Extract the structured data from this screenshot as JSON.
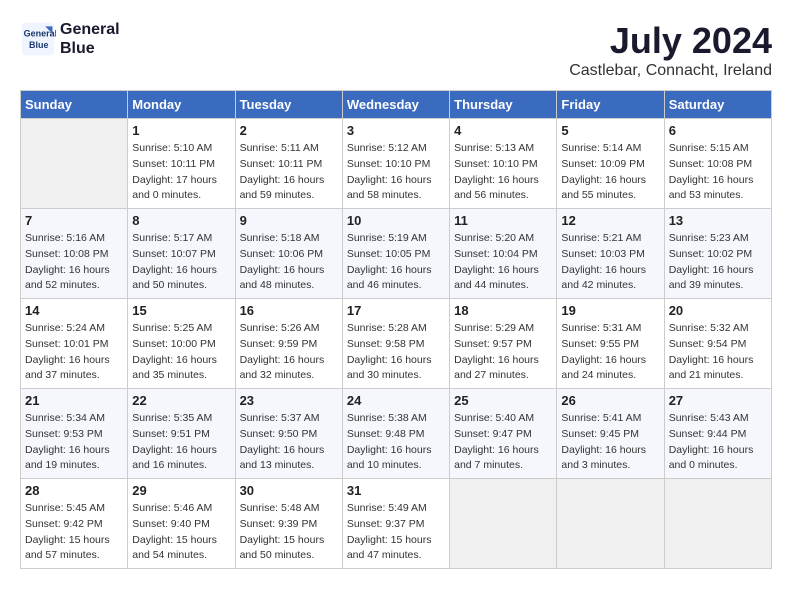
{
  "header": {
    "logo_line1": "General",
    "logo_line2": "Blue",
    "month": "July 2024",
    "location": "Castlebar, Connacht, Ireland"
  },
  "calendar": {
    "days_of_week": [
      "Sunday",
      "Monday",
      "Tuesday",
      "Wednesday",
      "Thursday",
      "Friday",
      "Saturday"
    ],
    "weeks": [
      [
        {
          "day": "",
          "empty": true
        },
        {
          "day": "1",
          "sunrise": "5:10 AM",
          "sunset": "10:11 PM",
          "daylight": "17 hours and 0 minutes."
        },
        {
          "day": "2",
          "sunrise": "5:11 AM",
          "sunset": "10:11 PM",
          "daylight": "16 hours and 59 minutes."
        },
        {
          "day": "3",
          "sunrise": "5:12 AM",
          "sunset": "10:10 PM",
          "daylight": "16 hours and 58 minutes."
        },
        {
          "day": "4",
          "sunrise": "5:13 AM",
          "sunset": "10:10 PM",
          "daylight": "16 hours and 56 minutes."
        },
        {
          "day": "5",
          "sunrise": "5:14 AM",
          "sunset": "10:09 PM",
          "daylight": "16 hours and 55 minutes."
        },
        {
          "day": "6",
          "sunrise": "5:15 AM",
          "sunset": "10:08 PM",
          "daylight": "16 hours and 53 minutes."
        }
      ],
      [
        {
          "day": "7",
          "sunrise": "5:16 AM",
          "sunset": "10:08 PM",
          "daylight": "16 hours and 52 minutes."
        },
        {
          "day": "8",
          "sunrise": "5:17 AM",
          "sunset": "10:07 PM",
          "daylight": "16 hours and 50 minutes."
        },
        {
          "day": "9",
          "sunrise": "5:18 AM",
          "sunset": "10:06 PM",
          "daylight": "16 hours and 48 minutes."
        },
        {
          "day": "10",
          "sunrise": "5:19 AM",
          "sunset": "10:05 PM",
          "daylight": "16 hours and 46 minutes."
        },
        {
          "day": "11",
          "sunrise": "5:20 AM",
          "sunset": "10:04 PM",
          "daylight": "16 hours and 44 minutes."
        },
        {
          "day": "12",
          "sunrise": "5:21 AM",
          "sunset": "10:03 PM",
          "daylight": "16 hours and 42 minutes."
        },
        {
          "day": "13",
          "sunrise": "5:23 AM",
          "sunset": "10:02 PM",
          "daylight": "16 hours and 39 minutes."
        }
      ],
      [
        {
          "day": "14",
          "sunrise": "5:24 AM",
          "sunset": "10:01 PM",
          "daylight": "16 hours and 37 minutes."
        },
        {
          "day": "15",
          "sunrise": "5:25 AM",
          "sunset": "10:00 PM",
          "daylight": "16 hours and 35 minutes."
        },
        {
          "day": "16",
          "sunrise": "5:26 AM",
          "sunset": "9:59 PM",
          "daylight": "16 hours and 32 minutes."
        },
        {
          "day": "17",
          "sunrise": "5:28 AM",
          "sunset": "9:58 PM",
          "daylight": "16 hours and 30 minutes."
        },
        {
          "day": "18",
          "sunrise": "5:29 AM",
          "sunset": "9:57 PM",
          "daylight": "16 hours and 27 minutes."
        },
        {
          "day": "19",
          "sunrise": "5:31 AM",
          "sunset": "9:55 PM",
          "daylight": "16 hours and 24 minutes."
        },
        {
          "day": "20",
          "sunrise": "5:32 AM",
          "sunset": "9:54 PM",
          "daylight": "16 hours and 21 minutes."
        }
      ],
      [
        {
          "day": "21",
          "sunrise": "5:34 AM",
          "sunset": "9:53 PM",
          "daylight": "16 hours and 19 minutes."
        },
        {
          "day": "22",
          "sunrise": "5:35 AM",
          "sunset": "9:51 PM",
          "daylight": "16 hours and 16 minutes."
        },
        {
          "day": "23",
          "sunrise": "5:37 AM",
          "sunset": "9:50 PM",
          "daylight": "16 hours and 13 minutes."
        },
        {
          "day": "24",
          "sunrise": "5:38 AM",
          "sunset": "9:48 PM",
          "daylight": "16 hours and 10 minutes."
        },
        {
          "day": "25",
          "sunrise": "5:40 AM",
          "sunset": "9:47 PM",
          "daylight": "16 hours and 7 minutes."
        },
        {
          "day": "26",
          "sunrise": "5:41 AM",
          "sunset": "9:45 PM",
          "daylight": "16 hours and 3 minutes."
        },
        {
          "day": "27",
          "sunrise": "5:43 AM",
          "sunset": "9:44 PM",
          "daylight": "16 hours and 0 minutes."
        }
      ],
      [
        {
          "day": "28",
          "sunrise": "5:45 AM",
          "sunset": "9:42 PM",
          "daylight": "15 hours and 57 minutes."
        },
        {
          "day": "29",
          "sunrise": "5:46 AM",
          "sunset": "9:40 PM",
          "daylight": "15 hours and 54 minutes."
        },
        {
          "day": "30",
          "sunrise": "5:48 AM",
          "sunset": "9:39 PM",
          "daylight": "15 hours and 50 minutes."
        },
        {
          "day": "31",
          "sunrise": "5:49 AM",
          "sunset": "9:37 PM",
          "daylight": "15 hours and 47 minutes."
        },
        {
          "day": "",
          "empty": true
        },
        {
          "day": "",
          "empty": true
        },
        {
          "day": "",
          "empty": true
        }
      ]
    ]
  }
}
